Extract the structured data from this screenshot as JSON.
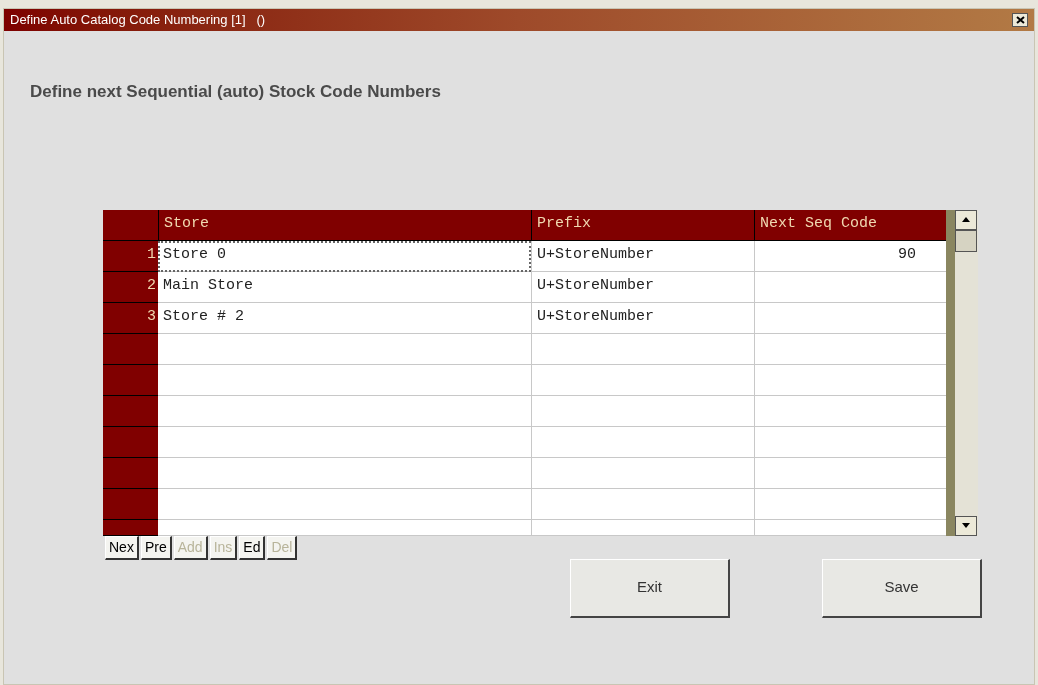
{
  "window": {
    "title": "Define Auto Catalog Code Numbering [1]   ()"
  },
  "heading": "Define next Sequential (auto) Stock Code Numbers",
  "table": {
    "columns": [
      "Store",
      "Prefix",
      "Next Seq Code"
    ],
    "rows": [
      {
        "number": "1",
        "store": "Store 0",
        "prefix": "U+StoreNumber",
        "next_seq_code": "90",
        "focused": true
      },
      {
        "number": "2",
        "store": "Main Store",
        "prefix": "U+StoreNumber",
        "focused": false
      },
      {
        "number": "3",
        "store": "Store # 2",
        "prefix": "U+StoreNumber",
        "focused": false
      }
    ]
  },
  "nav_buttons": [
    {
      "label": "Nex",
      "disabled": false
    },
    {
      "label": "Pre",
      "disabled": false
    },
    {
      "label": "Add",
      "disabled": true
    },
    {
      "label": "Ins",
      "disabled": true
    },
    {
      "label": "Ed",
      "disabled": false
    },
    {
      "label": "Del",
      "disabled": true
    }
  ],
  "buttons": [
    "Exit",
    "Save"
  ]
}
